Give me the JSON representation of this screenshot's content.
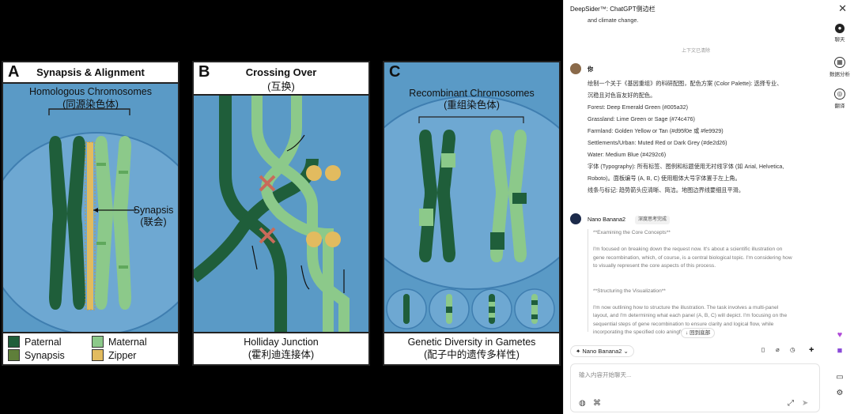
{
  "figure": {
    "panel_a": {
      "letter": "A",
      "title": "Synapsis & Alignment",
      "label_en": "Homologous Chromosomes",
      "label_zh": "(同源染色体)",
      "synapsis_en": "Synapsis",
      "synapsis_zh": "(联会)",
      "legend": [
        {
          "label": "Paternal",
          "color": "#1f5e3a"
        },
        {
          "label": "Maternal",
          "color": "#8cc98a"
        },
        {
          "label": "Synapsis",
          "color": "#5f7f3a"
        },
        {
          "label": "Zipper",
          "color": "#e2bb5f"
        }
      ]
    },
    "panel_b": {
      "letter": "B",
      "title": "Crossing Over",
      "title_zh": "(互换)",
      "caption_en": "Holliday Junction",
      "caption_zh": "(霍利迪连接体)"
    },
    "panel_c": {
      "letter": "C",
      "label_en": "Recombinant Chromosomes",
      "label_zh": "(重组染色体)",
      "caption_en": "Genetic Diversity in Gametes",
      "caption_zh": "(配子中的遗传多样性)"
    },
    "colors": {
      "paternal": "#1f5e3a",
      "maternal": "#8cc98a",
      "water": "#5a9ac6",
      "zipper": "#e2bb5f",
      "cross": "#c96a5a"
    }
  },
  "sidebar": {
    "title": "DeepSider™: ChatGPT侧边栏",
    "close_icon": "close-icon",
    "rail": [
      {
        "label": "聊天",
        "icon": "chat-icon"
      },
      {
        "label": "数据分析",
        "icon": "data-analysis-icon"
      },
      {
        "label": "翻译",
        "icon": "translate-icon"
      }
    ],
    "prev_text": "and climate change.",
    "context_divider": "上下文已清除",
    "user": {
      "name": "你",
      "lines": [
        "绘制一个关于《基因重组》的科研配图，配色方案 (Color Palette): 选择专业、",
        "沉稳且对色盲友好的配色。",
        "Forest: Deep Emerald Green (#005a32)",
        "Grassland: Lime Green or Sage (#74c476)",
        "Farmland: Golden Yellow or Tan (#d95f0e 或 #fe9929)",
        "Settlements/Urban: Muted Red or Dark Grey (#de2d26)",
        "Water: Medium Blue (#4292c6)",
        "字体 (Typography): 所有标签、图例和标题使用无衬线字体 (如 Arial, Helvetica,",
        "Roboto)。面板编号 (A, B, C) 使用粗体大号字体置于左上角。",
        "线条与标记: 趋势箭头应清晰、简洁。地图边界线要细且平滑。"
      ]
    },
    "bot": {
      "name": "Nano Banana2",
      "badge": "深度思考完成",
      "thinking": [
        "**Examining the Core Concepts**",
        "",
        "I'm focused on breaking down the request now. It's about a scientific illustration on",
        "gene recombination, which, of course, is a central biological topic. I'm considering how",
        "to visually represent the core aspects of this process.",
        "",
        "",
        "**Structuring the Visualization**",
        "",
        "I'm now outlining how to structure the illustration. The task involves a multi-panel",
        "layout, and I'm determining what each panel (A, B, C) will depict. I'm focusing on the",
        "sequential steps of gene recombination to ensure clarity and logical flow, while",
        "incorporating the specified colo           aningful way."
      ],
      "back_to_bottom": "回到底部"
    },
    "toolbar": {
      "model": "Nano Banana2"
    },
    "input": {
      "placeholder": "输入内容开始聊天..."
    }
  }
}
